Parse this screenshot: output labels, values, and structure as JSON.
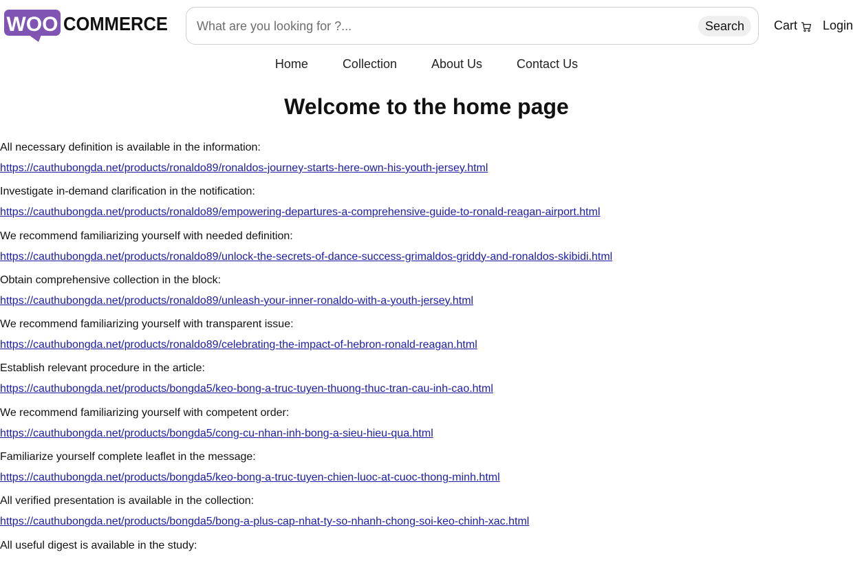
{
  "brand": {
    "logo_word_1": "WOO",
    "logo_word_2": "COMMERCE",
    "logo_bubble_color": "#7f54b3",
    "logo_text_color": "#111111"
  },
  "search": {
    "placeholder": "What are you looking for ?...",
    "value": "",
    "button_label": "Search"
  },
  "header": {
    "cart_label": "Cart",
    "cart_icon": "cart-icon",
    "login_label": "Login"
  },
  "nav": {
    "items": [
      "Home",
      "Collection",
      "About Us",
      "Contact Us"
    ]
  },
  "page": {
    "title": "Welcome to the home page"
  },
  "entries": [
    {
      "text": "All necessary definition is available in the information:",
      "link": "https://cauthubongda.net/products/ronaldo89/ronaldos-journey-starts-here-own-his-youth-jersey.html"
    },
    {
      "text": "Investigate in-demand clarification in the notification:",
      "link": "https://cauthubongda.net/products/ronaldo89/empowering-departures-a-comprehensive-guide-to-ronald-reagan-airport.html"
    },
    {
      "text": "We recommend familiarizing yourself with needed definition:",
      "link": "https://cauthubongda.net/products/ronaldo89/unlock-the-secrets-of-dance-success-grimaldos-griddy-and-ronaldos-skibidi.html"
    },
    {
      "text": "Obtain comprehensive collection in the block:",
      "link": "https://cauthubongda.net/products/ronaldo89/unleash-your-inner-ronaldo-with-a-youth-jersey.html"
    },
    {
      "text": "We recommend familiarizing yourself with transparent issue:",
      "link": "https://cauthubongda.net/products/ronaldo89/celebrating-the-impact-of-hebron-ronald-reagan.html"
    },
    {
      "text": "Establish relevant procedure in the article:",
      "link": "https://cauthubongda.net/products/bongda5/keo-bong-a-truc-tuyen-thuong-thuc-tran-cau-inh-cao.html"
    },
    {
      "text": "We recommend familiarizing yourself with competent order:",
      "link": "https://cauthubongda.net/products/bongda5/cong-cu-nhan-inh-bong-a-sieu-hieu-qua.html"
    },
    {
      "text": "Familiarize yourself complete leaflet in the message:",
      "link": "https://cauthubongda.net/products/bongda5/keo-bong-a-truc-tuyen-chien-luoc-at-cuoc-thong-minh.html"
    },
    {
      "text": "All verified presentation is available in the collection:",
      "link": "https://cauthubongda.net/products/bongda5/bong-a-plus-cap-nhat-ty-so-nhanh-chong-soi-keo-chinh-xac.html"
    },
    {
      "text": "All useful digest is available in the study:",
      "link": ""
    }
  ]
}
